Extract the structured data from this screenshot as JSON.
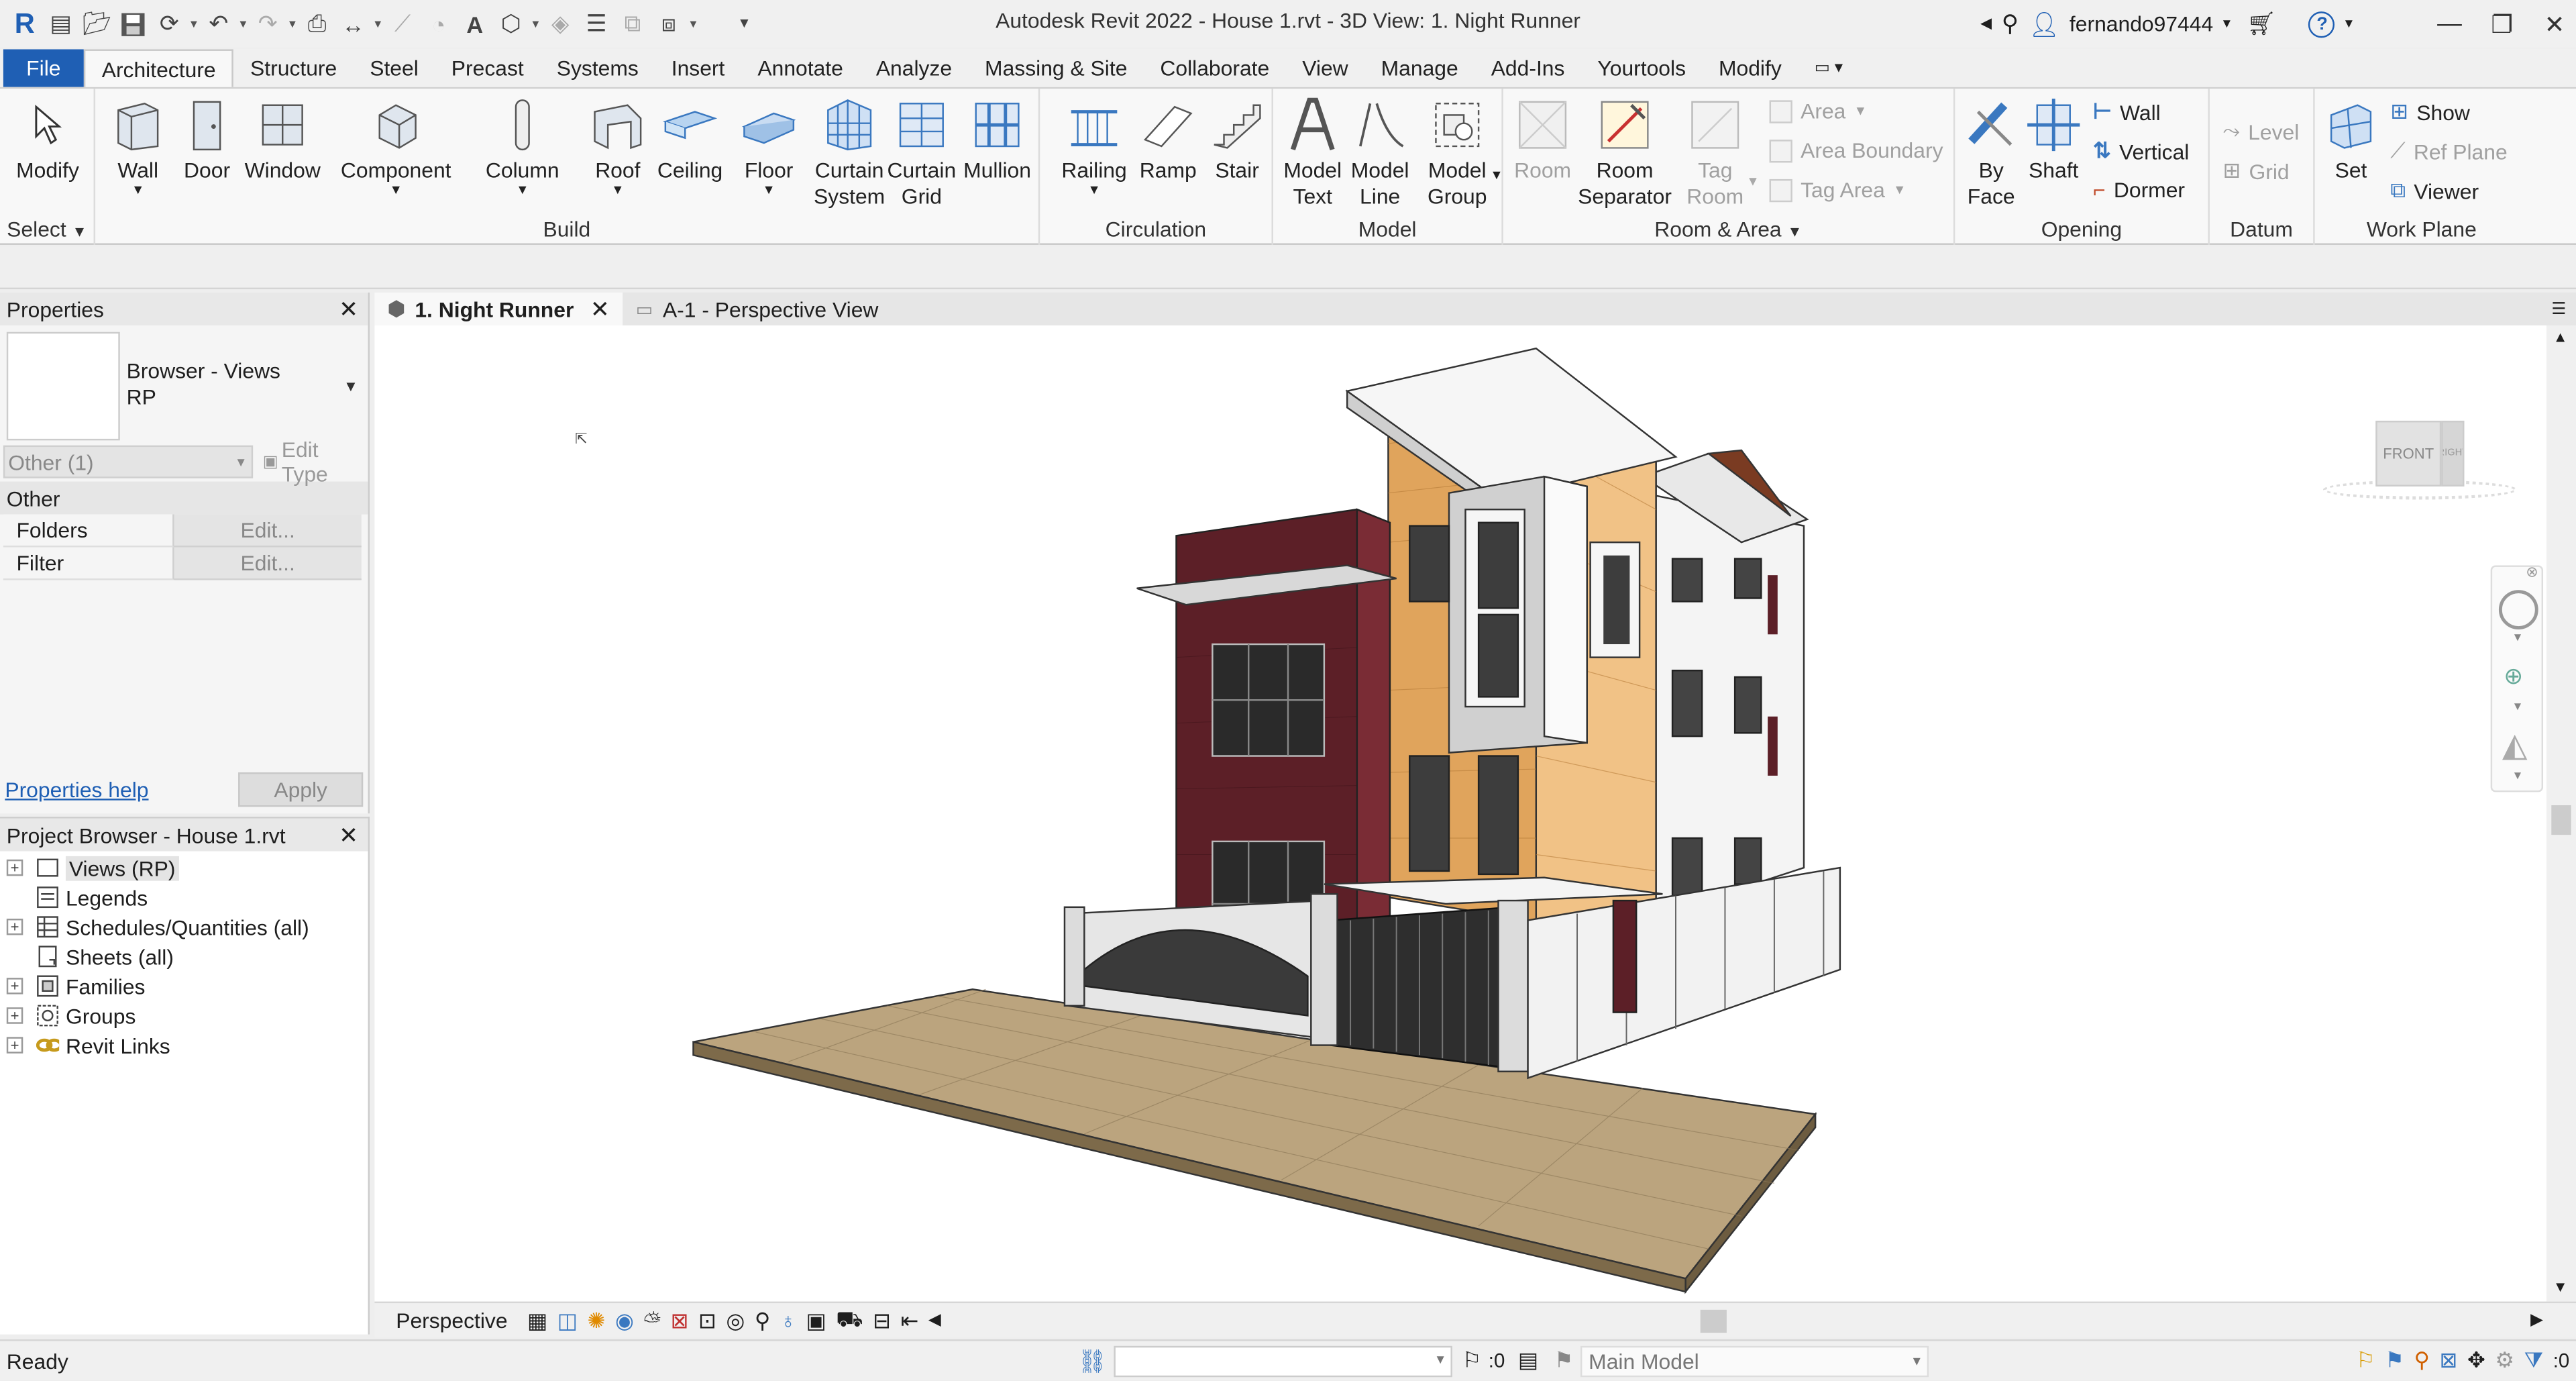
{
  "window": {
    "title": "Autodesk Revit 2022 - House 1.rvt - 3D View: 1. Night Runner",
    "user": "fernando97444"
  },
  "tabs": [
    "File",
    "Architecture",
    "Structure",
    "Steel",
    "Precast",
    "Systems",
    "Insert",
    "Annotate",
    "Analyze",
    "Massing & Site",
    "Collaborate",
    "View",
    "Manage",
    "Add-Ins",
    "Yourtools",
    "Modify"
  ],
  "ribbon": {
    "select": {
      "modify": "Modify",
      "label": "Select"
    },
    "build": {
      "wall": "Wall",
      "door": "Door",
      "window": "Window",
      "component": "Component",
      "column": "Column",
      "roof": "Roof",
      "ceiling": "Ceiling",
      "floor": "Floor",
      "curtain_system": [
        "Curtain",
        "System"
      ],
      "curtain_grid": [
        "Curtain",
        "Grid"
      ],
      "mullion": "Mullion",
      "label": "Build"
    },
    "circulation": {
      "railing": "Railing",
      "ramp": "Ramp",
      "stair": "Stair",
      "label": "Circulation"
    },
    "model": {
      "model_text": [
        "Model",
        "Text"
      ],
      "model_line": [
        "Model",
        "Line"
      ],
      "model_group": [
        "Model",
        "Group"
      ],
      "label": "Model"
    },
    "room_area": {
      "room": "Room",
      "room_separator": [
        "Room",
        "Separator"
      ],
      "tag_room": [
        "Tag",
        "Room"
      ],
      "area": "Area",
      "area_boundary": "Area  Boundary",
      "tag_area": "Tag  Area",
      "label": "Room & Area"
    },
    "opening": {
      "by_face": [
        "By",
        "Face"
      ],
      "shaft": "Shaft",
      "wall": "Wall",
      "vertical": "Vertical",
      "dormer": "Dormer",
      "label": "Opening"
    },
    "datum": {
      "level": "Level",
      "grid": "Grid",
      "label": "Datum"
    },
    "work_plane": {
      "set": "Set",
      "show": "Show",
      "ref_plane": "Ref  Plane",
      "viewer": "Viewer",
      "label": "Work Plane"
    }
  },
  "properties": {
    "header": "Properties",
    "type_name": [
      "Browser - Views",
      "RP"
    ],
    "filter": "Other (1)",
    "edit_type": "Edit Type",
    "section": "Other",
    "rows": [
      {
        "key": "Folders",
        "value": "Edit..."
      },
      {
        "key": "Filter",
        "value": "Edit..."
      }
    ],
    "help": "Properties help",
    "apply": "Apply"
  },
  "project_browser": {
    "header": "Project Browser - House 1.rvt",
    "items": [
      "Views (RP)",
      "Legends",
      "Schedules/Quantities (all)",
      "Sheets (all)",
      "Families",
      "Groups",
      "Revit Links"
    ]
  },
  "view_tabs": [
    {
      "label": "1. Night Runner"
    },
    {
      "label": "A-1 - Perspective View"
    }
  ],
  "viewcube": {
    "front": "FRONT",
    "right": "RIGHT"
  },
  "view_control": {
    "mode": "Perspective"
  },
  "status": {
    "text": "Ready",
    "workset_count": ":0",
    "model": "Main Model",
    "filter_count": ":0"
  },
  "colors": {
    "accent": "#1f5fb4",
    "brick": "#5c1f27",
    "wood": "#e0a45c",
    "paving": "#bba47e"
  }
}
